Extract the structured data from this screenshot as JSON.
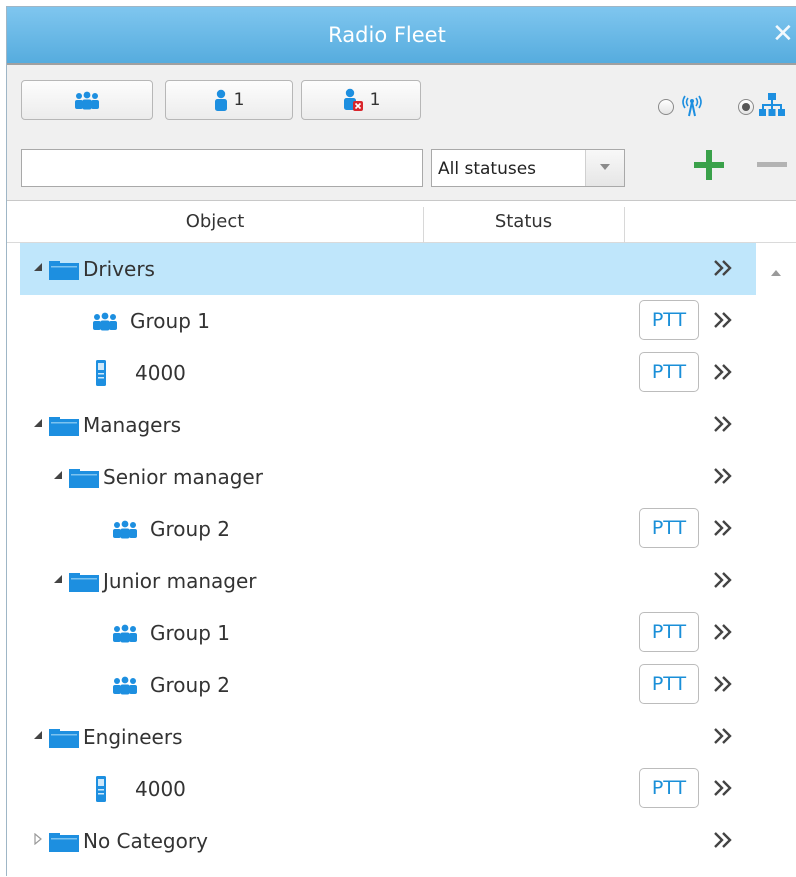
{
  "window": {
    "title": "Radio Fleet",
    "close_glyph": "✕"
  },
  "toolbar": {
    "filters": [
      {
        "name": "groups",
        "icon": "group-icon",
        "count": ""
      },
      {
        "name": "users",
        "icon": "user-icon",
        "count": "1"
      },
      {
        "name": "offline-users",
        "icon": "user-offline-icon",
        "count": "1"
      }
    ],
    "search": {
      "value": "",
      "placeholder": ""
    },
    "status_select": {
      "selected": "All statuses"
    },
    "view_mode": {
      "options": [
        "radio-network-icon",
        "hierarchy-icon"
      ],
      "selected": "hierarchy-icon"
    },
    "add_icon": "plus-icon",
    "remove_icon": "minus-icon"
  },
  "columns": {
    "object": "Object",
    "status": "Status"
  },
  "tree": [
    {
      "label": "Drivers",
      "type": "category",
      "level": 0,
      "expanded": true,
      "selected": true,
      "ptt": false
    },
    {
      "label": "Group 1",
      "type": "group",
      "level": 1,
      "ptt": true
    },
    {
      "label": "4000",
      "type": "radio",
      "level": 1,
      "ptt": true
    },
    {
      "label": "Managers",
      "type": "category",
      "level": 0,
      "expanded": true,
      "ptt": false
    },
    {
      "label": "Senior manager",
      "type": "category",
      "level": 1,
      "expanded": true,
      "ptt": false
    },
    {
      "label": "Group 2",
      "type": "group",
      "level": 2,
      "ptt": true
    },
    {
      "label": "Junior manager",
      "type": "category",
      "level": 1,
      "expanded": true,
      "ptt": false
    },
    {
      "label": "Group 1",
      "type": "group",
      "level": 2,
      "ptt": true
    },
    {
      "label": "Group 2",
      "type": "group",
      "level": 2,
      "ptt": true
    },
    {
      "label": "Engineers",
      "type": "category",
      "level": 0,
      "expanded": true,
      "ptt": false
    },
    {
      "label": "4000",
      "type": "radio",
      "level": 1,
      "ptt": true
    },
    {
      "label": "No Category",
      "type": "category",
      "level": 0,
      "expanded": false,
      "ptt": false
    }
  ],
  "ptt_label": "PTT",
  "colors": {
    "titlebar": "#5fb3e3",
    "selection": "#bfe6fb",
    "accent": "#1a8fd8",
    "add": "#3aa14a"
  }
}
